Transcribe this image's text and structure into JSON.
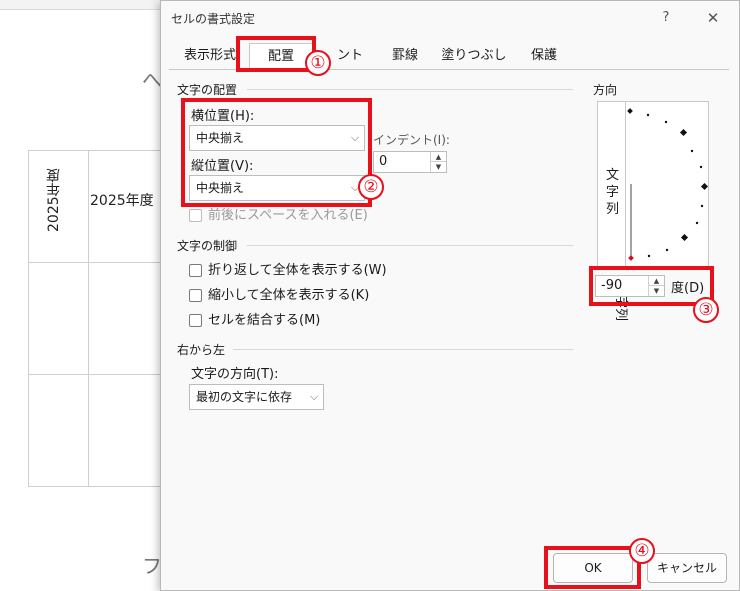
{
  "background": {
    "frag1": "へ",
    "frag2": "フ",
    "vertical_cell": "2025年度",
    "cell": "2025年度"
  },
  "dialog": {
    "title": "セルの書式設定",
    "help": "?",
    "close": "✕"
  },
  "tabs": [
    {
      "label": "表示形式"
    },
    {
      "label": "配置"
    },
    {
      "label": "ント"
    },
    {
      "label": "罫線"
    },
    {
      "label": "塗りつぶし"
    },
    {
      "label": "保護"
    }
  ],
  "alignment": {
    "section": "文字の配置",
    "horizontal_label": "横位置(H):",
    "horizontal_value": "中央揃え",
    "vertical_label": "縦位置(V):",
    "vertical_value": "中央揃え",
    "indent_label": "インデント(I):",
    "indent_value": "0",
    "justify_distributed": "前後にスペースを入れる(E)"
  },
  "text_control": {
    "section": "文字の制御",
    "wrap": "折り返して全体を表示する(W)",
    "shrink": "縮小して全体を表示する(K)",
    "merge": "セルを結合する(M)"
  },
  "rtl": {
    "section": "右から左",
    "direction_label": "文字の方向(T):",
    "direction_value": "最初の文字に依存"
  },
  "orientation": {
    "section": "方向",
    "vertical_chars": [
      "文",
      "字",
      "列"
    ],
    "rotated_text": "文字列",
    "degrees_value": "-90",
    "degrees_label": "度(D)"
  },
  "buttons": {
    "ok": "OK",
    "cancel": "キャンセル"
  },
  "annotations": {
    "b1": "①",
    "b2": "②",
    "b3": "③",
    "b4": "④",
    "color": "#e8101b"
  }
}
